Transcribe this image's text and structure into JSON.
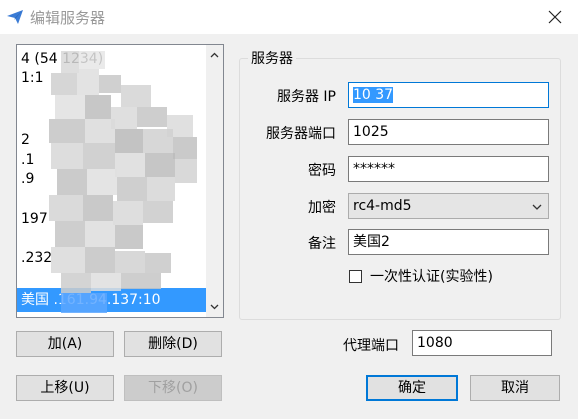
{
  "window": {
    "title": "编辑服务器",
    "icon": "paper-plane-icon",
    "close_icon": "close-icon"
  },
  "server_list": {
    "items": [
      "4      (54   1234)",
      "                1:1",
      "",
      "                  2",
      "",
      "            .1",
      "          .9",
      "",
      "           197",
      "",
      "            .232",
      "",
      "美国    .161.94.137:10"
    ],
    "selected_index": 12
  },
  "group": {
    "title": "服务器"
  },
  "fields": {
    "server_ip_label": "服务器 IP",
    "server_ip_value": "10             37",
    "server_port_label": "服务器端口",
    "server_port_value": "1025",
    "password_label": "密码",
    "password_value": "******",
    "encryption_label": "加密",
    "encryption_value": "rc4-md5",
    "remarks_label": "备注",
    "remarks_value": "美国2",
    "onetime_auth_label": "一次性认证(实验性)",
    "onetime_auth_checked": false,
    "proxy_port_label": "代理端口",
    "proxy_port_value": "1080"
  },
  "buttons": {
    "add": "加(A)",
    "delete": "删除(D)",
    "move_up": "上移(U)",
    "move_down": "下移(O)",
    "ok": "确定",
    "cancel": "取消"
  },
  "colors": {
    "selection": "#3399ff",
    "focus_border": "#0078d7",
    "window_bg": "#f0f0f0"
  }
}
